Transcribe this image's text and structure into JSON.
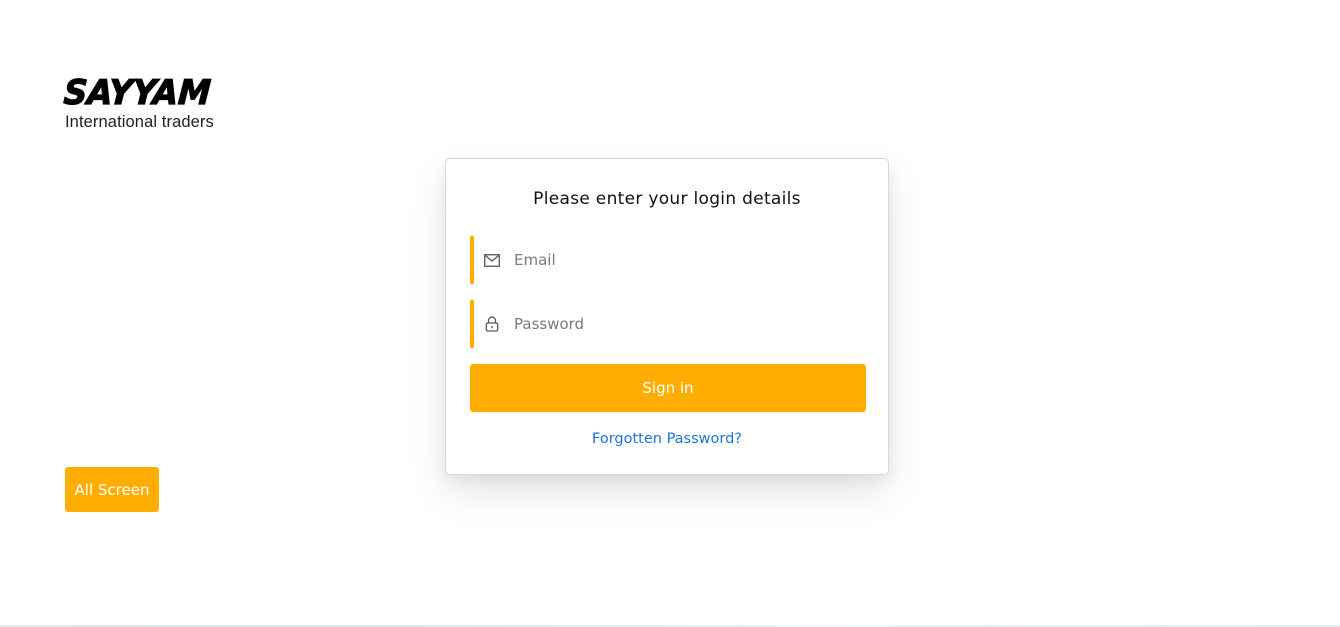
{
  "brand": {
    "name": "SAYYAM",
    "tagline": "International traders"
  },
  "all_screen_button": {
    "label": "All Screen"
  },
  "login": {
    "title": "Please enter your login details",
    "email": {
      "placeholder": "Email",
      "value": "",
      "icon": "envelope-icon"
    },
    "password": {
      "placeholder": "Password",
      "value": "",
      "icon": "lock-icon"
    },
    "submit_label": "Sign in",
    "forgot_label": "Forgotten Password?"
  },
  "colors": {
    "accent": "#ffad00",
    "link": "#1a73d9",
    "card_border": "#d5d8df"
  }
}
